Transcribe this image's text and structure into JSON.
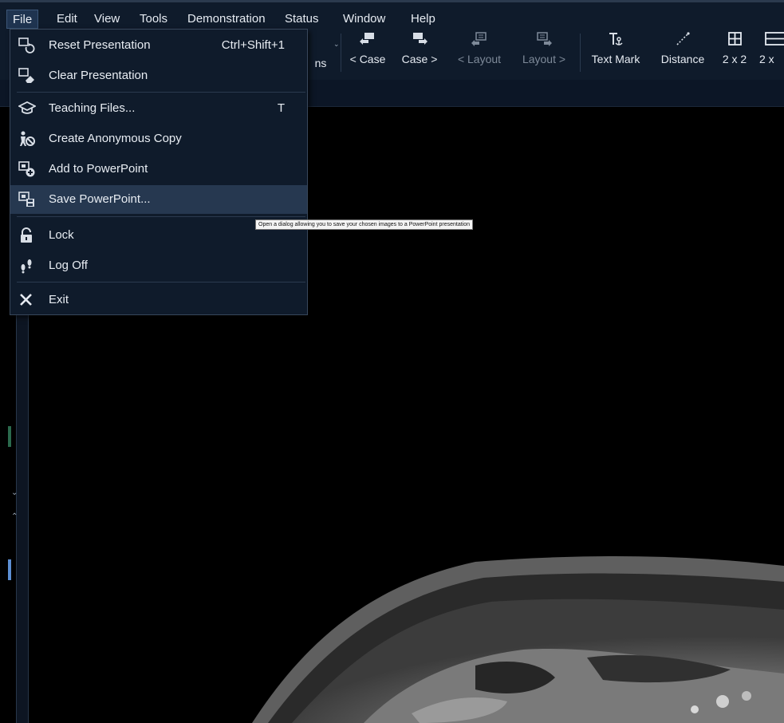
{
  "menubar": {
    "items": [
      "File",
      "Edit",
      "View",
      "Tools",
      "Demonstration",
      "Status",
      "Window",
      "Help"
    ]
  },
  "toolbar": {
    "partial_label": "ns",
    "buttons": [
      {
        "label": "< Case",
        "icon": "case-previous-icon",
        "enabled": true
      },
      {
        "label": "Case >",
        "icon": "case-next-icon",
        "enabled": true
      },
      {
        "label": "< Layout",
        "icon": "layout-previous-icon",
        "enabled": false
      },
      {
        "label": "Layout >",
        "icon": "layout-next-icon",
        "enabled": false
      },
      {
        "label": "Text Mark",
        "icon": "text-mark-icon",
        "enabled": true
      },
      {
        "label": "Distance",
        "icon": "distance-icon",
        "enabled": true
      },
      {
        "label": "2 x 2",
        "icon": "grid-2x2-icon",
        "enabled": true
      },
      {
        "label": "2 x",
        "icon": "grid-2x1-icon",
        "enabled": true
      }
    ]
  },
  "file_menu": {
    "items": [
      {
        "label": "Reset Presentation",
        "shortcut": "Ctrl+Shift+1",
        "icon": "reset-presentation-icon"
      },
      {
        "label": "Clear Presentation",
        "shortcut": "",
        "icon": "clear-presentation-icon"
      },
      {
        "label": "Teaching Files...",
        "shortcut": "T",
        "icon": "graduation-cap-icon"
      },
      {
        "label": "Create Anonymous Copy",
        "shortcut": "",
        "icon": "anonymous-person-icon"
      },
      {
        "label": "Add to PowerPoint",
        "shortcut": "",
        "icon": "add-powerpoint-icon"
      },
      {
        "label": "Save PowerPoint...",
        "shortcut": "",
        "icon": "save-powerpoint-icon"
      },
      {
        "label": "Lock",
        "shortcut": "",
        "icon": "lock-icon"
      },
      {
        "label": "Log Off",
        "shortcut": "",
        "icon": "footsteps-icon"
      },
      {
        "label": "Exit",
        "shortcut": "",
        "icon": "close-icon"
      }
    ],
    "highlighted_index": 5
  },
  "tooltip": {
    "text": "Open a dialog allowing you to save your chosen images to a PowerPoint presentation"
  },
  "colors": {
    "menu_bg": "#0f1b2b",
    "highlight": "#263850",
    "viewport_bg": "#000000"
  }
}
